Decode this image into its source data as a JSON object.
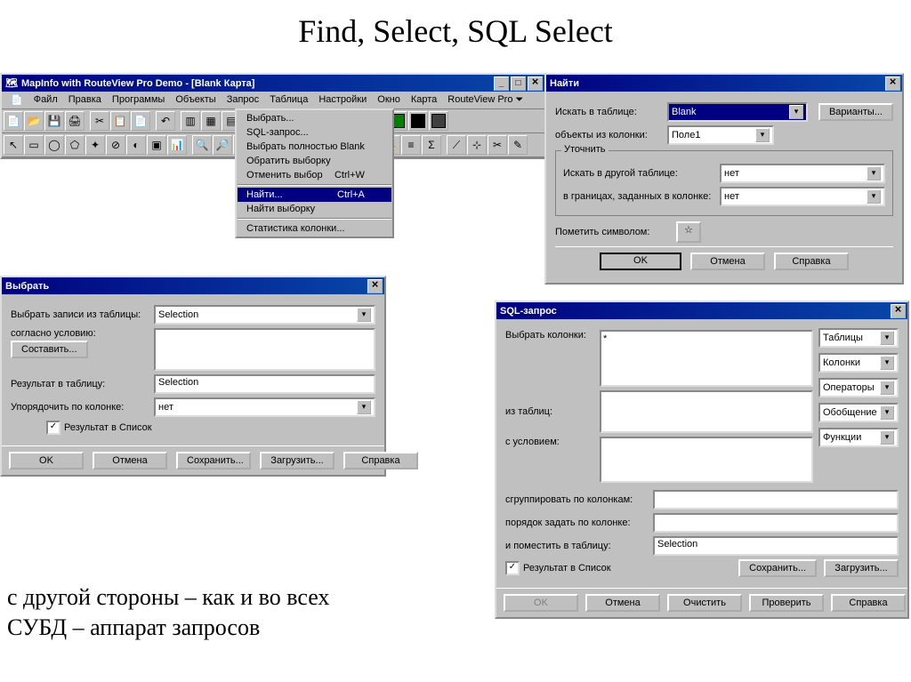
{
  "slide": {
    "title": "Find, Select, SQL Select",
    "footnote1": "с другой стороны – как и во всех",
    "footnote2": "СУБД – аппарат запросов"
  },
  "mainwin": {
    "title": "MapInfo with RouteView Pro Demo - [Blank Карта]",
    "menubar": [
      "Файл",
      "Правка",
      "Программы",
      "Объекты",
      "Запрос",
      "Таблица",
      "Настройки",
      "Окно",
      "Карта",
      "RouteView Pro ⏷"
    ],
    "dropdown": {
      "items": [
        {
          "label": "Выбрать...",
          "sc": ""
        },
        {
          "label": "SQL-запрос...",
          "sc": ""
        },
        {
          "label": "Выбрать полностью Blank",
          "sc": ""
        },
        {
          "label": "Обратить выборку",
          "sc": ""
        },
        {
          "label": "Отменить выбор",
          "sc": "Ctrl+W"
        },
        {
          "label": "Найти...",
          "sc": "Ctrl+A",
          "sel": true,
          "sep_before": true
        },
        {
          "label": "Найти выборку",
          "sc": ""
        },
        {
          "label": "Статистика колонки...",
          "sc": "",
          "sep_before": true
        }
      ]
    }
  },
  "find": {
    "title": "Найти",
    "search_table_lbl": "Искать в таблице:",
    "search_table_val": "Blank",
    "objects_col_lbl": "объекты из колонки:",
    "objects_col_val": "Поле1",
    "group_title": "Уточнить",
    "other_table_lbl": "Искать в другой таблице:",
    "other_table_val": "нет",
    "bounds_lbl": "в границах, заданных в колонке:",
    "bounds_val": "нет",
    "mark_lbl": "Пометить символом:",
    "variants": "Варианты...",
    "ok": "OK",
    "cancel": "Отмена",
    "help": "Справка"
  },
  "select": {
    "title": "Выбрать",
    "records_lbl": "Выбрать записи из таблицы:",
    "records_val": "Selection",
    "cond_lbl": "согласно условию:",
    "compose": "Составить...",
    "result_lbl": "Результат в таблицу:",
    "result_val": "Selection",
    "order_lbl": "Упорядочить по колонке:",
    "order_val": "нет",
    "cb": "Результат в Список",
    "ok": "OK",
    "cancel": "Отмена",
    "save": "Сохранить...",
    "load": "Загрузить...",
    "help": "Справка"
  },
  "sql": {
    "title": "SQL-запрос",
    "cols_lbl": "Выбрать колонки:",
    "cols_val": "*",
    "from_lbl": "из таблиц:",
    "where_lbl": "с условием:",
    "group_lbl": "сгруппировать по колонкам:",
    "order_lbl": "порядок задать по колонке:",
    "into_lbl": "и поместить в таблицу:",
    "into_val": "Selection",
    "cb": "Результат в Список",
    "tables": "Таблицы",
    "columns": "Колонки",
    "ops": "Операторы",
    "agg": "Обобщение",
    "func": "Функции",
    "save": "Сохранить...",
    "load": "Загрузить...",
    "ok": "OK",
    "cancel": "Отмена",
    "clear": "Очистить",
    "verify": "Проверить",
    "help": "Справка"
  }
}
